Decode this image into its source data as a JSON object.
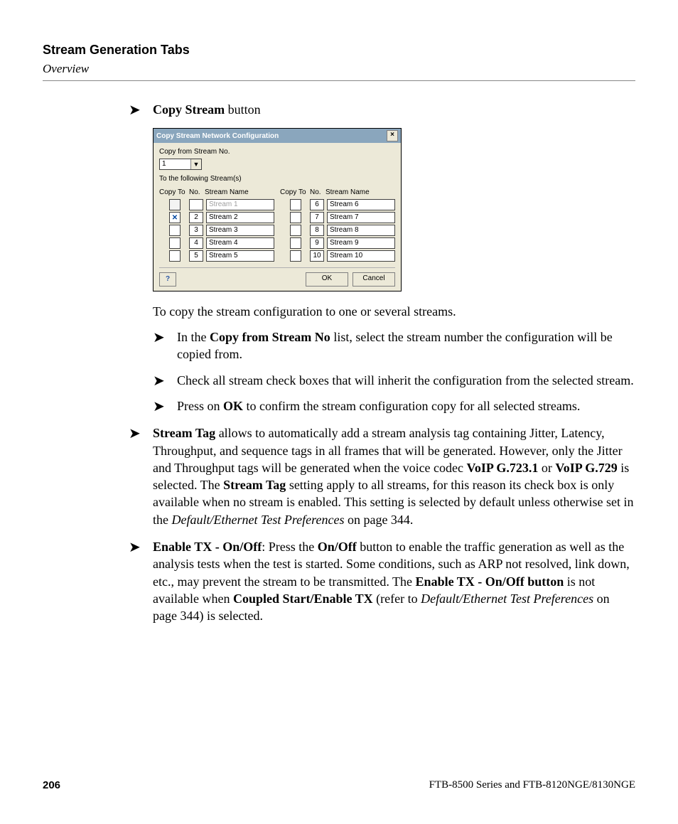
{
  "header": {
    "chapter_title": "Stream Generation Tabs",
    "section_title": "Overview"
  },
  "top_item": {
    "label_bold": "Copy Stream",
    "label_rest": " button"
  },
  "dialog": {
    "title": "Copy Stream Network Configuration",
    "copy_from_label": "Copy from Stream No.",
    "combo_value": "1",
    "to_following_label": "To the following Stream(s)",
    "col_headers": {
      "copy_to": "Copy To",
      "no": "No.",
      "stream_name": "Stream Name"
    },
    "left_rows": [
      {
        "no": "",
        "name": "Stream 1",
        "checked": false,
        "disabled_name": true,
        "blank_no": true
      },
      {
        "no": "2",
        "name": "Stream 2",
        "checked": true
      },
      {
        "no": "3",
        "name": "Stream 3",
        "checked": false
      },
      {
        "no": "4",
        "name": "Stream 4",
        "checked": false
      },
      {
        "no": "5",
        "name": "Stream 5",
        "checked": false
      }
    ],
    "right_rows": [
      {
        "no": "6",
        "name": "Stream 6",
        "checked": false
      },
      {
        "no": "7",
        "name": "Stream 7",
        "checked": false
      },
      {
        "no": "8",
        "name": "Stream 8",
        "checked": false
      },
      {
        "no": "9",
        "name": "Stream 9",
        "checked": false
      },
      {
        "no": "10",
        "name": "Stream 10",
        "checked": false
      }
    ],
    "buttons": {
      "help": "?",
      "ok": "OK",
      "cancel": "Cancel"
    }
  },
  "lead_para": "To copy the stream configuration to one or several streams.",
  "sub_items": {
    "a": {
      "pre": "In the ",
      "b1": "Copy from Stream No",
      "post": " list, select the stream number the configuration will be copied from."
    },
    "b": {
      "text": "Check all stream check boxes that will inherit the configuration from the selected stream."
    },
    "c": {
      "pre": "Press on ",
      "b1": "OK",
      "post": " to confirm the stream configuration copy for all selected streams."
    }
  },
  "stream_tag": {
    "b1": "Stream Tag",
    "t1": " allows to automatically add a stream analysis tag containing Jitter, Latency, Throughput, and sequence tags in all frames that will be generated. However, only the Jitter and Throughput tags will be generated when the voice codec ",
    "b2": "VoIP G.723.1",
    "t2": " or ",
    "b3": "VoIP G.729",
    "t3": " is selected. The ",
    "b4": "Stream Tag",
    "t4": " setting apply to all streams, for this reason its check box is only available when no stream is enabled. This setting is selected by default unless otherwise set in the ",
    "i1": "Default/Ethernet Test Preferences",
    "t5": " on page 344."
  },
  "enable_tx": {
    "b1": "Enable TX - On/Off",
    "t1": ": Press the ",
    "b2": "On/Off",
    "t2": " button to enable the traffic generation as well as the analysis tests when the test is started. Some conditions, such as ARP not resolved, link down, etc., may prevent the stream to be transmitted. The ",
    "b3": "Enable TX - On/Off button",
    "t3": " is not available when ",
    "b4": "Coupled Start/Enable TX",
    "t4": " (refer to ",
    "i1": "Default/Ethernet Test Preferences",
    "t5": " on page 344) is selected."
  },
  "footer": {
    "page_number": "206",
    "product_line": "FTB-8500 Series and FTB-8120NGE/8130NGE"
  }
}
